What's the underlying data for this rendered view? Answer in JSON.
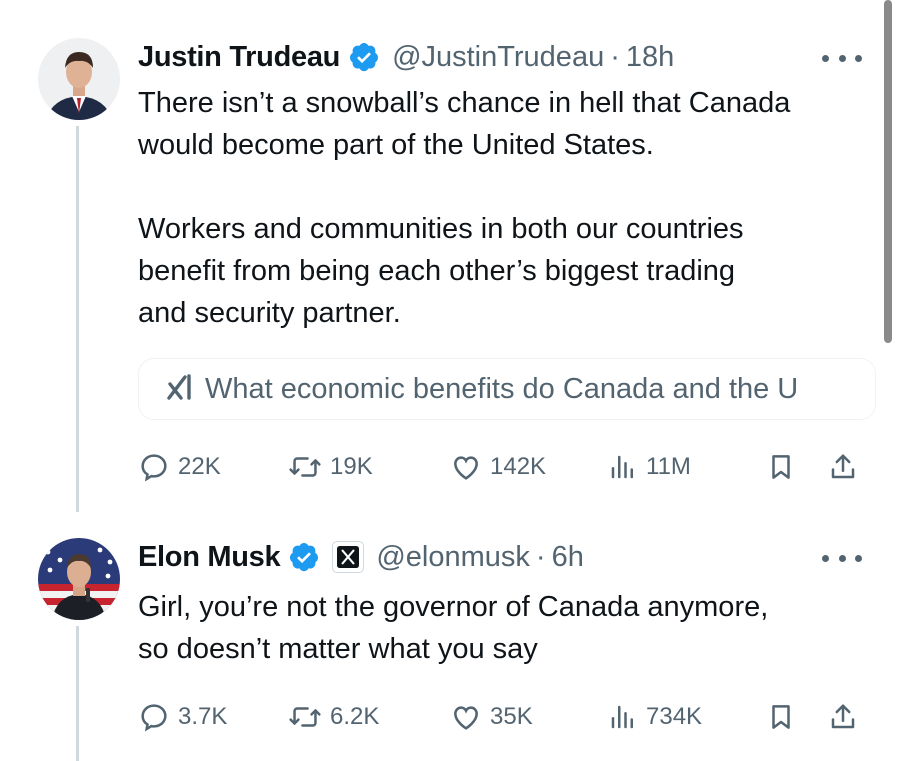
{
  "tweets": [
    {
      "name": "Justin Trudeau",
      "handle": "@JustinTrudeau",
      "separator": "·",
      "time": "18h",
      "text": [
        "There isn’t a snowball’s chance in hell that Canada",
        "would become part of the United States.",
        "",
        "Workers and communities in both our countries",
        "benefit from being each other’s biggest trading",
        "and security partner."
      ],
      "grok_prompt": "What economic benefits do Canada and the U",
      "stats": {
        "replies": "22K",
        "reposts": "19K",
        "likes": "142K",
        "views": "11M"
      }
    },
    {
      "name": "Elon Musk",
      "handle": "@elonmusk",
      "separator": "·",
      "time": "6h",
      "affiliate_badge": "X",
      "text": [
        "Girl, you’re not the governor of Canada anymore,",
        "so doesn’t matter what you say"
      ],
      "stats": {
        "replies": "3.7K",
        "reposts": "6.2K",
        "likes": "35K",
        "views": "734K"
      }
    }
  ],
  "colors": {
    "verified": "#1d9bf0",
    "secondary_text": "#536471",
    "primary_text": "#0f1419",
    "thread_line": "#cfd9de"
  }
}
